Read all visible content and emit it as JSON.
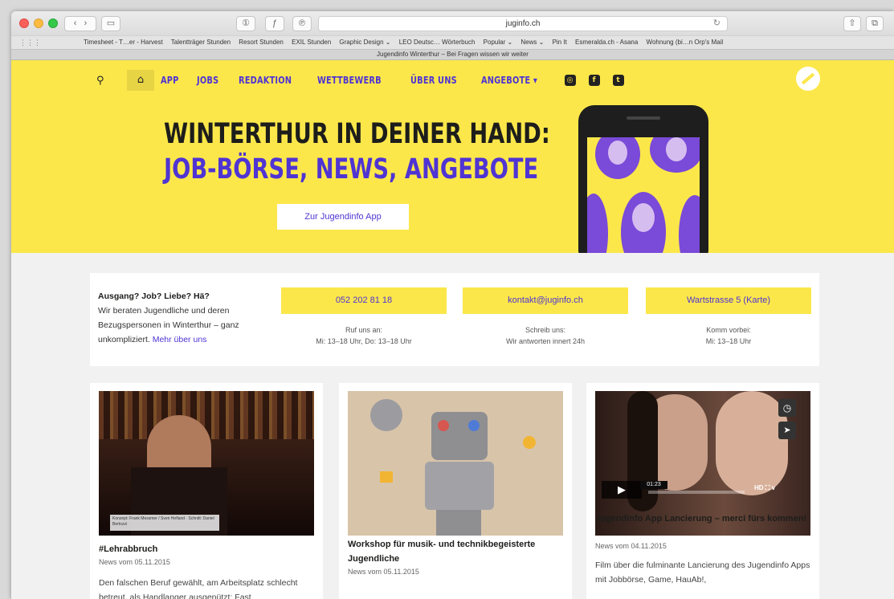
{
  "browser": {
    "url": "juginfo.ch",
    "tab_title": "Jugendinfo Winterthur – Bei Fragen wissen wir weiter",
    "bookmarks": [
      "Timesheet - T…er - Harvest",
      "Talentträger Stunden",
      "Resort Stunden",
      "EXIL Stunden",
      "Graphic Design ⌄",
      "LEO Deutsc… Wörterbuch",
      "Popular ⌄",
      "News ⌄",
      "Pin It",
      "Esmeralda.ch - Asana",
      "Wohnung (bi…n Orp's Mail"
    ]
  },
  "nav": {
    "items": [
      "APP",
      "JOBS",
      "REDAKTION",
      "WETTBEWERB",
      "ÜBER UNS",
      "ANGEBOTE ▾"
    ],
    "social": [
      "Instagram",
      "Facebook",
      "Twitter"
    ]
  },
  "hero": {
    "line1": "WINTERTHUR IN DEINER HAND:",
    "line2": "JOB-BÖRSE, NEWS, ANGEBOTE",
    "cta": "Zur Jugendinfo App"
  },
  "info": {
    "heading": "Ausgang? Job? Liebe? Hä?",
    "text": "Wir beraten Jugendliche und deren Bezugspersonen in Winterthur – ganz unkompliziert.",
    "more": "Mehr über uns",
    "phone": "052 202 81 18",
    "phone_sub1": "Ruf uns an:",
    "phone_sub2": "Mi: 13–18 Uhr, Do: 13–18 Uhr",
    "email": "kontakt@juginfo.ch",
    "email_sub1": "Schreib uns:",
    "email_sub2": "Wir antworten innert 24h",
    "address": "Wartstrasse 5 (Karte)",
    "address_sub1": "Komm vorbei:",
    "address_sub2": "Mi: 13–18 Uhr"
  },
  "cards": [
    {
      "title": "#Lehrabbruch",
      "date": "News vom 05.11.2015",
      "body": "Den falschen Beruf gewählt, am Arbeitsplatz schlecht betreut, als Handlanger ausgenützt: Fast",
      "caption": "Konzept: Frank Messmer / Sven Hefland · Schnitt: Daniel Bertozzi"
    },
    {
      "title": "Workshop für musik- und technikbegeisterte Jugendliche",
      "date": "News vom 05.11.2015",
      "body": ""
    },
    {
      "title": "Jugendinfo App Lancierung – merci fürs kommen!",
      "date": "News vom 04.11.2015",
      "body": "Film über die fulminante Lancierung des Jugendinfo Apps mit Jobbörse, Game, HauAb!,",
      "video_time": "01:23"
    }
  ]
}
